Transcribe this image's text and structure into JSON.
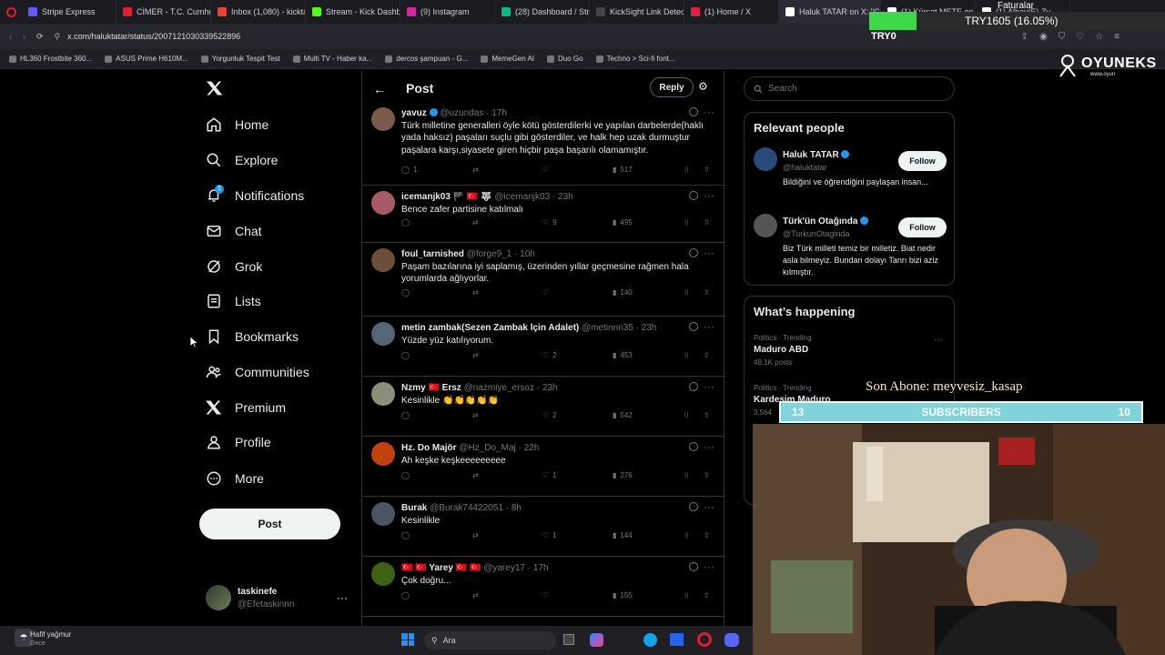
{
  "browser": {
    "tabs": [
      {
        "label": "Stripe Express",
        "color": "#635bff"
      },
      {
        "label": "CİMER - T.C. Cumhurb",
        "color": "#e11d2e"
      },
      {
        "label": "Inbox (1,080) - kickta",
        "color": "#ea4335"
      },
      {
        "label": "Stream - Kick Dashbo",
        "color": "#53fc18"
      },
      {
        "label": "(9) Instagram",
        "color": "#d6249f"
      },
      {
        "label": "(28) Dashboard / Stre",
        "color": "#10b981"
      },
      {
        "label": "KickSight Link Detect",
        "color": "#444"
      },
      {
        "label": "(1) Home / X",
        "color": "#e11d48"
      },
      {
        "label": "Haluk TATAR on X: \"Cl",
        "color": "#ffffff"
      },
      {
        "label": "(1) Kürşat METE on X",
        "color": "#ffffff"
      },
      {
        "label": "(1) Albay(E) Zy",
        "color": "#ffffff"
      }
    ],
    "url": "x.com/haluktatar/status/2007121030339522896",
    "bookmarks": [
      "HL360 Frostbite 360...",
      "ASUS Prime H610M...",
      "Yorgunluk Tespit Test",
      "Multi TV - Haber ka...",
      "dercos şampuan - G...",
      "MemeGen AI",
      "Duo Go",
      "Techno > Sci-fi font..."
    ]
  },
  "overlay": {
    "try_label": "TRY1605 (16.05%)",
    "try_small": "TRY0",
    "faturalar": "Faturalar",
    "brand": "OYUNEKS",
    "brand_sub": "www.oyun",
    "son_abone": "Son Abone: meyvesiz_kasap",
    "sub_left": "13",
    "sub_label": "SUBSCRIBERS",
    "sub_right": "10"
  },
  "sidebar": {
    "nav": [
      "Home",
      "Explore",
      "Notifications",
      "Chat",
      "Grok",
      "Lists",
      "Bookmarks",
      "Communities",
      "Premium",
      "Profile",
      "More"
    ],
    "notif_badge": "1",
    "post_label": "Post",
    "account_name": "taskinefe",
    "account_handle": "@Efetaskinnn"
  },
  "center": {
    "title": "Post",
    "reply_label": "Reply",
    "replies": [
      {
        "name": "yavuz",
        "verified": true,
        "handle": "@uzundas",
        "time": "17h",
        "text": "Türk milletine generalleri öyle kötü gösterdilerki ve yapılan darbelerde(haklı yada haksız) paşaları suçlu gibi gösterdiler, ve halk hep uzak durmuştur paşalara karşı,siyasete giren hiçbir paşa başarılı olamamıştır.",
        "replies": "1",
        "likes": "",
        "views": "517",
        "avatar": "#7a5a4a"
      },
      {
        "name": "icemanjk03 🏴 🇹🇷 🐺",
        "verified": false,
        "handle": "@icemanjk03",
        "time": "23h",
        "text": "Bence zafer partisine katılmalı",
        "replies": "",
        "likes": "9",
        "views": "495",
        "avatar": "#a85a66"
      },
      {
        "name": "foul_tarnished",
        "verified": false,
        "handle": "@forge9_1",
        "time": "10h",
        "text": "Paşam bazılarına iyi saplamış, üzerinden yıllar geçmesine rağmen hala yorumlarda ağlıyorlar.",
        "replies": "",
        "likes": "",
        "views": "140",
        "avatar": "#6b4f3a"
      },
      {
        "name": "metin zambak(Sezen Zambak İçin Adalet)",
        "verified": false,
        "handle": "@metinnn35",
        "time": "23h",
        "text": "Yüzde yüz katılıyorum.",
        "replies": "",
        "likes": "2",
        "views": "453",
        "avatar": "#556677"
      },
      {
        "name": "Nzmy 🇹🇷 Ersz",
        "verified": false,
        "handle": "@nazmiye_ersoz",
        "time": "23h",
        "text": "Kesinlikle 👏👏👏👏👏",
        "replies": "",
        "likes": "2",
        "views": "542",
        "avatar": "#8a8f7a"
      },
      {
        "name": "Hz. Do Majör",
        "verified": false,
        "handle": "@Hz_Do_Maj",
        "time": "22h",
        "text": "Ah keşke keşkeeeeeeeee",
        "replies": "",
        "likes": "1",
        "views": "276",
        "avatar": "#c2410c"
      },
      {
        "name": "Burak",
        "verified": false,
        "handle": "@Burak74422051",
        "time": "8h",
        "text": "Kesinlikle",
        "replies": "",
        "likes": "1",
        "views": "144",
        "avatar": "#4b5563"
      },
      {
        "name": "🇹🇷 🇹🇷 Yarey 🇹🇷 🇹🇷",
        "verified": false,
        "handle": "@yarey17",
        "time": "17h",
        "text": "Çok doğru...",
        "replies": "",
        "likes": "",
        "views": "155",
        "avatar": "#3f6212"
      }
    ]
  },
  "right": {
    "search_placeholder": "Search",
    "relevant_title": "Relevant people",
    "people": [
      {
        "name": "Haluk TATAR",
        "handle": "@haluktatar",
        "bio": "Bildiğini ve öğrendiğini paylaşan insan...",
        "follow": "Follow",
        "avatar": "#2b4a7a"
      },
      {
        "name": "Türk'ün Otağında",
        "handle": "@TurkunOtaginda",
        "bio": "Biz Türk milleti temiz bir milletiz. Biat nedir asla bilmeyiz. Bundan dolayı Tanrı bizi aziz kılmıştır.",
        "follow": "Follow",
        "avatar": "#555"
      }
    ],
    "happening_title": "What’s happening",
    "trends": [
      {
        "meta": "Politics · Trending",
        "name": "Maduro ABD",
        "count": "48.1K posts"
      },
      {
        "meta": "Politics · Trending",
        "name": "Kardeşim Maduro",
        "count": "3,564"
      }
    ]
  },
  "taskbar": {
    "weather_title": "Hafif yağmur",
    "weather_sub": "Gece",
    "search_label": "Ara"
  }
}
